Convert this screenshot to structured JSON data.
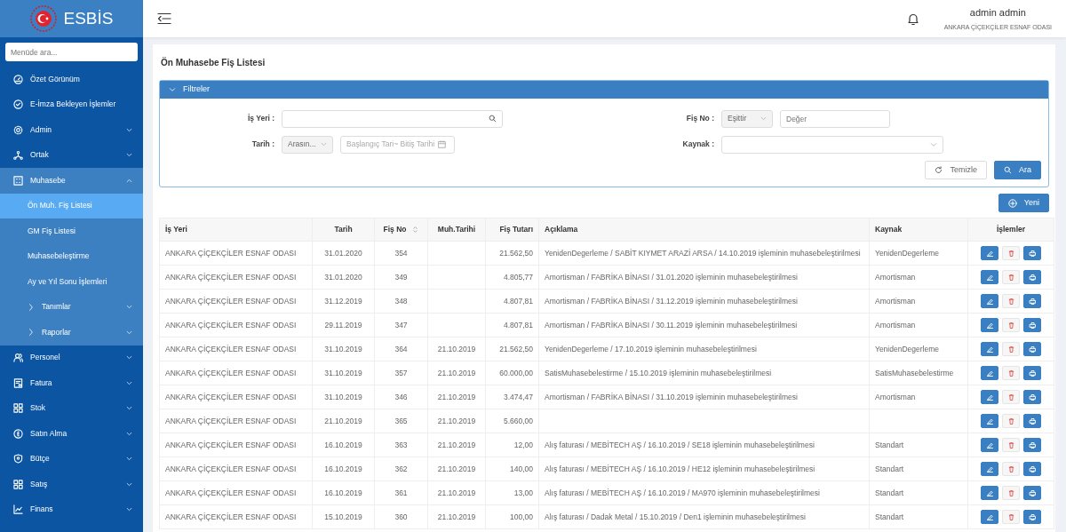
{
  "brand": {
    "name": "ESBİS"
  },
  "sidebar": {
    "search": {
      "placeholder": "Menüde ara..."
    },
    "items": [
      {
        "label": "Özet Görünüm",
        "kind": "link",
        "selected": false
      },
      {
        "label": "E-İmza Bekleyen İşlemler",
        "kind": "link",
        "selected": false
      },
      {
        "label": "Admin",
        "kind": "group",
        "expanded": false,
        "selected": false
      },
      {
        "label": "Ortak",
        "kind": "group",
        "expanded": false,
        "selected": false
      },
      {
        "label": "Muhasebe",
        "kind": "group",
        "expanded": true,
        "selected": false,
        "children": [
          {
            "label": "Ön Muh. Fiş Listesi",
            "kind": "link",
            "selected": true
          },
          {
            "label": "GM Fiş Listesi",
            "kind": "link",
            "selected": false
          },
          {
            "label": "Muhasebeleştirme",
            "kind": "link",
            "selected": false
          },
          {
            "label": "Ay ve Yıl Sonu İşlemleri",
            "kind": "link",
            "selected": false
          },
          {
            "label": "Tanımlar",
            "kind": "group",
            "expanded": false,
            "selected": false
          },
          {
            "label": "Raporlar",
            "kind": "group",
            "expanded": false,
            "selected": false
          }
        ]
      },
      {
        "label": "Personel",
        "kind": "group",
        "expanded": false,
        "selected": false
      },
      {
        "label": "Fatura",
        "kind": "group",
        "expanded": false,
        "selected": false
      },
      {
        "label": "Stok",
        "kind": "group",
        "expanded": false,
        "selected": false
      },
      {
        "label": "Satın Alma",
        "kind": "group",
        "expanded": false,
        "selected": false
      },
      {
        "label": "Bütçe",
        "kind": "group",
        "expanded": false,
        "selected": false
      },
      {
        "label": "Satış",
        "kind": "group",
        "expanded": false,
        "selected": false
      },
      {
        "label": "Finans",
        "kind": "group",
        "expanded": false,
        "selected": false
      }
    ]
  },
  "header": {
    "user_name": "admin admin",
    "organization": "ANKARA ÇİÇEKÇİLER ESNAF ODASI"
  },
  "page": {
    "title": "Ön Muhasebe Fiş Listesi"
  },
  "filters": {
    "title": "Filtreler",
    "expanded": true,
    "is_yeri": {
      "label": "İş Yeri :"
    },
    "tarih": {
      "label": "Tarih :",
      "operator": "Arasın...",
      "start_placeholder": "Başlangıç Tari",
      "separator": "~",
      "end_placeholder": "Bitiş Tarihi"
    },
    "fis_no": {
      "label": "Fiş No :",
      "operator": "Eşittir",
      "placeholder": "Değer"
    },
    "kaynak": {
      "label": "Kaynak :"
    },
    "buttons": {
      "clear": "Temizle",
      "search": "Ara"
    }
  },
  "new_button": "Yeni",
  "table": {
    "columns": [
      {
        "label": "İş Yeri",
        "sortable": false
      },
      {
        "label": "Tarih",
        "sortable": false
      },
      {
        "label": "Fiş No",
        "sortable": true
      },
      {
        "label": "Muh.Tarihi",
        "sortable": false
      },
      {
        "label": "Fiş Tutarı",
        "sortable": false
      },
      {
        "label": "Açıklama",
        "sortable": false
      },
      {
        "label": "Kaynak",
        "sortable": false
      },
      {
        "label": "İşlemler",
        "sortable": false
      }
    ],
    "rows": [
      [
        "ANKARA ÇİÇEKÇİLER ESNAF ODASI",
        "31.01.2020",
        "354",
        "",
        "21.562,50",
        "YenidenDegerleme / SABİT KIYMET ARAZİ ARSA / 14.10.2019 işleminin muhasebeleştirilmesi",
        "YenidenDegerleme"
      ],
      [
        "ANKARA ÇİÇEKÇİLER ESNAF ODASI",
        "31.01.2020",
        "349",
        "",
        "4.805,77",
        "Amortisman / FABRİKA BİNASI / 31.01.2020 işleminin muhasebeleştirilmesi",
        "Amortisman"
      ],
      [
        "ANKARA ÇİÇEKÇİLER ESNAF ODASI",
        "31.12.2019",
        "348",
        "",
        "4.807,81",
        "Amortisman / FABRİKA BİNASI / 31.12.2019 işleminin muhasebeleştirilmesi",
        "Amortisman"
      ],
      [
        "ANKARA ÇİÇEKÇİLER ESNAF ODASI",
        "29.11.2019",
        "347",
        "",
        "4.807,81",
        "Amortisman / FABRİKA BİNASI / 30.11.2019 işleminin muhasebeleştirilmesi",
        "Amortisman"
      ],
      [
        "ANKARA ÇİÇEKÇİLER ESNAF ODASI",
        "31.10.2019",
        "364",
        "21.10.2019",
        "21.562,50",
        "YenidenDegerleme / 17.10.2019 işleminin muhasebeleştirilmesi",
        "YenidenDegerleme"
      ],
      [
        "ANKARA ÇİÇEKÇİLER ESNAF ODASI",
        "31.10.2019",
        "357",
        "21.10.2019",
        "60.000,00",
        "SatisMuhasebelestirme / 15.10.2019 işleminin muhasebeleştirilmesi",
        "SatisMuhasebelestirme"
      ],
      [
        "ANKARA ÇİÇEKÇİLER ESNAF ODASI",
        "31.10.2019",
        "346",
        "21.10.2019",
        "3.474,47",
        "Amortisman / FABRİKA BİNASI / 31.10.2019 işleminin muhasebeleştirilmesi",
        "Amortisman"
      ],
      [
        "ANKARA ÇİÇEKÇİLER ESNAF ODASI",
        "21.10.2019",
        "365",
        "21.10.2019",
        "5.660,00",
        "",
        ""
      ],
      [
        "ANKARA ÇİÇEKÇİLER ESNAF ODASI",
        "16.10.2019",
        "363",
        "21.10.2019",
        "12,00",
        "Alış faturası / MEBİTECH AŞ / 16.10.2019 / SE18 işleminin muhasebeleştirilmesi",
        "Standart"
      ],
      [
        "ANKARA ÇİÇEKÇİLER ESNAF ODASI",
        "16.10.2019",
        "362",
        "21.10.2019",
        "140,00",
        "Alış faturası / MEBİTECH AŞ / 16.10.2019 / HE12 işleminin muhasebeleştirilmesi",
        "Standart"
      ],
      [
        "ANKARA ÇİÇEKÇİLER ESNAF ODASI",
        "16.10.2019",
        "361",
        "21.10.2019",
        "13,00",
        "Alış faturası / MEBİTECH AŞ / 16.10.2019 / MA970 işleminin muhasebeleştirilmesi",
        "Standart"
      ],
      [
        "ANKARA ÇİÇEKÇİLER ESNAF ODASI",
        "15.10.2019",
        "360",
        "21.10.2019",
        "100,00",
        "Alış faturası / Dadak Metal / 15.10.2019 / Den1 işleminin muhasebeleştirilmesi",
        "Standart"
      ]
    ]
  }
}
